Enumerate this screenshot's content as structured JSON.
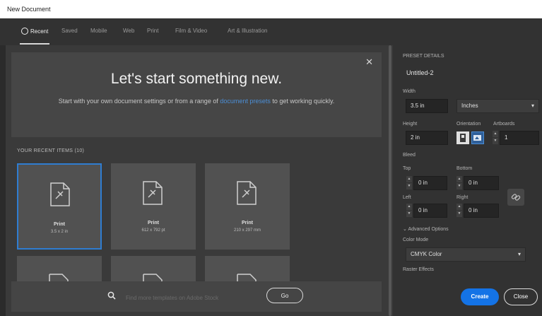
{
  "window": {
    "title": "New Document"
  },
  "tabs": [
    {
      "label": "Recent",
      "active": true
    },
    {
      "label": "Saved"
    },
    {
      "label": "Mobile"
    },
    {
      "label": "Web"
    },
    {
      "label": "Print"
    },
    {
      "label": "Film & Video"
    },
    {
      "label": "Art & Illustration"
    }
  ],
  "hero": {
    "title": "Let's start something new.",
    "subtitle_pre": "Start with your own document settings or from a range of",
    "subtitle_link": "document presets",
    "subtitle_post": "to get working quickly."
  },
  "recent": {
    "label": "YOUR RECENT ITEMS (10)",
    "items": [
      {
        "name": "Print",
        "size": "3.5 x 2 in",
        "selected": true
      },
      {
        "name": "Print",
        "size": "612 x 792 pt"
      },
      {
        "name": "Print",
        "size": "210 x 297 mm"
      }
    ]
  },
  "search": {
    "placeholder": "Find more templates on Adobe Stock",
    "go_label": "Go"
  },
  "preset": {
    "section_label": "PRESET DETAILS",
    "name": "Untitled-2",
    "width_label": "Width",
    "width_value": "3.5 in",
    "units": "Inches",
    "height_label": "Height",
    "height_value": "2 in",
    "orientation_label": "Orientation",
    "artboards_label": "Artboards",
    "artboards_value": "1",
    "bleed_label": "Bleed",
    "top_label": "Top",
    "top_value": "0 in",
    "bottom_label": "Bottom",
    "bottom_value": "0 in",
    "left_label": "Left",
    "left_value": "0 in",
    "right_label": "Right",
    "right_value": "0 in",
    "advanced_label": "Advanced Options",
    "color_mode_label": "Color Mode",
    "color_mode_value": "CMYK Color",
    "raster_label": "Raster Effects"
  },
  "buttons": {
    "create": "Create",
    "close": "Close"
  },
  "colors": {
    "accent": "#1473e6",
    "selection": "#2f7dd1",
    "link": "#4b8ed6"
  }
}
